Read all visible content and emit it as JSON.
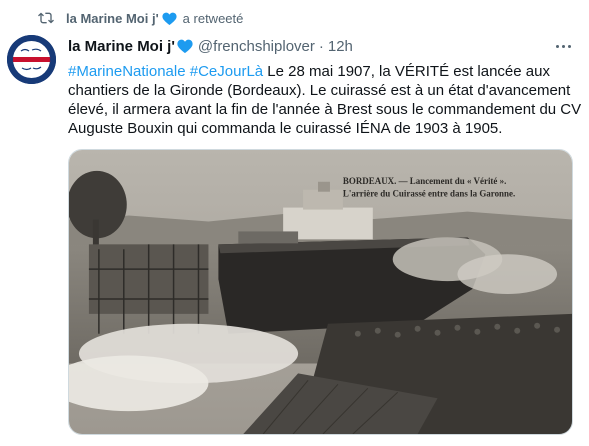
{
  "retweet": {
    "account": "la Marine Moi j'",
    "suffix": "a retweeté"
  },
  "tweet": {
    "author_name": "la Marine Moi j'",
    "handle": "@frenchshiplover",
    "separator": "·",
    "time": "12h",
    "text_lines": [
      {
        "hashtag1": "#MarineNationale",
        "hashtag2": "#CeJourLà",
        "rest": " Le 28 mai 1907, la VÉRITÉ est lancée aux"
      },
      {
        "text": "chantiers de la Gironde (Bordeaux). Le cuirassé est à un état d'avancement"
      },
      {
        "text": "élevé, il armera avant la fin de l'année à Brest sous le commandement du CV"
      },
      {
        "text": "Auguste Bouxin qui commanda le cuirassé IÉNA de 1903 à 1905."
      }
    ],
    "media_caption_line1": "BORDEAUX. — Lancement du « Vérité ».",
    "media_caption_line2": "L'arrière du Cuirassé entre dans la Garonne."
  },
  "colors": {
    "hashtag": "#1d9bf0",
    "heart": "#1d9bf0",
    "muted": "#536471",
    "avatar_bg": "#173a78",
    "photo_sepia": "#8e8a82"
  },
  "icons": {
    "retweet": "retweet-icon",
    "heart": "blue-heart-icon",
    "more": "more-options-icon"
  }
}
